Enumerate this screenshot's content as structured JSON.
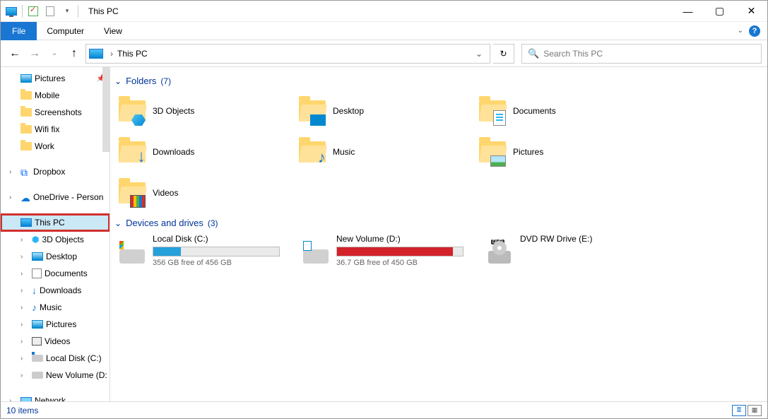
{
  "titlebar": {
    "title": "This PC"
  },
  "ribbon": {
    "file": "File",
    "tabs": [
      "Computer",
      "View"
    ]
  },
  "nav": {
    "address": "This PC",
    "search_placeholder": "Search This PC"
  },
  "tree": {
    "quick": [
      {
        "label": "Pictures",
        "icon": "pic",
        "pinned": true
      },
      {
        "label": "Mobile",
        "icon": "folder"
      },
      {
        "label": "Screenshots",
        "icon": "folder"
      },
      {
        "label": "Wifi fix",
        "icon": "folder"
      },
      {
        "label": "Work",
        "icon": "folder"
      }
    ],
    "dropbox": "Dropbox",
    "onedrive": "OneDrive - Person",
    "thispc": "This PC",
    "thispc_children": [
      {
        "label": "3D Objects",
        "icon": "3d"
      },
      {
        "label": "Desktop",
        "icon": "desktop"
      },
      {
        "label": "Documents",
        "icon": "doc"
      },
      {
        "label": "Downloads",
        "icon": "down"
      },
      {
        "label": "Music",
        "icon": "music"
      },
      {
        "label": "Pictures",
        "icon": "pic"
      },
      {
        "label": "Videos",
        "icon": "vid"
      },
      {
        "label": "Local Disk (C:)",
        "icon": "disk"
      },
      {
        "label": "New Volume (D:",
        "icon": "disknv"
      }
    ],
    "network": "Network"
  },
  "content": {
    "groups": [
      {
        "title": "Folders",
        "count": "(7)",
        "items": [
          {
            "label": "3D Objects",
            "overlay": "3d"
          },
          {
            "label": "Desktop",
            "overlay": "desktop"
          },
          {
            "label": "Documents",
            "overlay": "doc"
          },
          {
            "label": "Downloads",
            "overlay": "down"
          },
          {
            "label": "Music",
            "overlay": "music"
          },
          {
            "label": "Pictures",
            "overlay": "pic"
          },
          {
            "label": "Videos",
            "overlay": "vid"
          }
        ]
      },
      {
        "title": "Devices and drives",
        "count": "(3)",
        "drives": [
          {
            "name": "Local Disk (C:)",
            "free": "356 GB free of 456 GB",
            "fill_pct": 22,
            "color": "blue",
            "icon": "win"
          },
          {
            "name": "New Volume (D:)",
            "free": "36.7 GB free of 450 GB",
            "fill_pct": 92,
            "color": "red",
            "icon": "hdd"
          },
          {
            "name": "DVD RW Drive (E:)",
            "free": "",
            "fill_pct": 0,
            "color": "",
            "icon": "dvd"
          }
        ]
      }
    ]
  },
  "status": {
    "text": "10 items"
  }
}
